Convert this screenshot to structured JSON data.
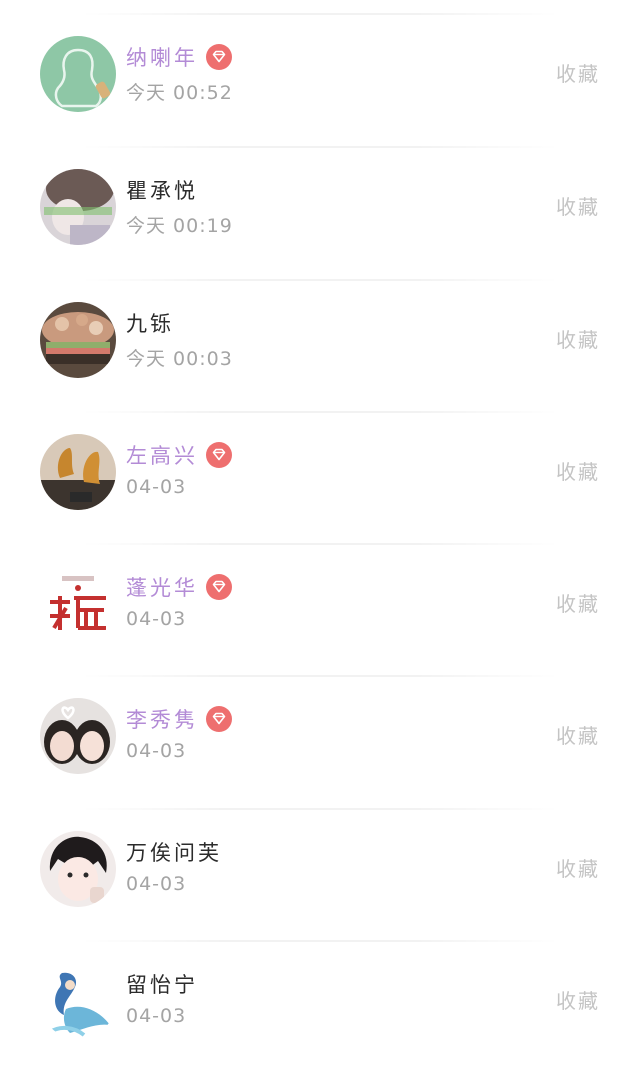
{
  "list": {
    "favorite_label": "收藏",
    "vip_color": "#b38bd6",
    "badge_color": "#ee6f6f",
    "items": [
      {
        "name": "纳喇年",
        "time": "今天 00:52",
        "vip": true,
        "avatar": "chalkboard-silhouette"
      },
      {
        "name": "瞿承悦",
        "time": "今天 00:19",
        "vip": false,
        "avatar": "photo-person"
      },
      {
        "name": "九铄",
        "time": "今天 00:03",
        "vip": false,
        "avatar": "food-dish"
      },
      {
        "name": "左高兴",
        "time": "04-03",
        "vip": true,
        "avatar": "roast-duck"
      },
      {
        "name": "蓬光华",
        "time": "04-03",
        "vip": true,
        "avatar": "calligraphy"
      },
      {
        "name": "李秀隽",
        "time": "04-03",
        "vip": true,
        "avatar": "couple-photo"
      },
      {
        "name": "万俟问芙",
        "time": "04-03",
        "vip": false,
        "avatar": "anime-boy"
      },
      {
        "name": "留怡宁",
        "time": "04-03",
        "vip": false,
        "avatar": "fairy-character"
      }
    ]
  }
}
